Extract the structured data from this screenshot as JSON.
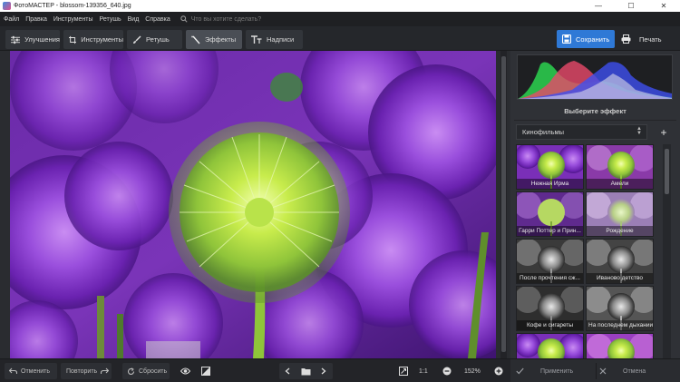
{
  "window": {
    "title": "ФотоМАСТЕР - blossom-139356_640.jpg",
    "minimize": "—",
    "maximize": "☐",
    "close": "✕"
  },
  "menu": {
    "items": [
      "Файл",
      "Правка",
      "Инструменты",
      "Ретушь",
      "Вид",
      "Справка"
    ],
    "search_placeholder": "Что вы хотите сделать?"
  },
  "toolbar": {
    "tabs": [
      {
        "label": "Улучшения",
        "icon": "sliders-icon"
      },
      {
        "label": "Инструменты",
        "icon": "crop-icon"
      },
      {
        "label": "Ретушь",
        "icon": "brush-icon"
      },
      {
        "label": "Эффекты",
        "icon": "magic-wand-icon",
        "active": true
      },
      {
        "label": "Надписи",
        "icon": "text-icon"
      }
    ],
    "save_label": "Сохранить",
    "print_label": "Печать"
  },
  "panel": {
    "title": "Выберите эффект",
    "category": "Кинофильмы",
    "effects": [
      {
        "label": "Нежная Ирма",
        "style": "color"
      },
      {
        "label": "Амели",
        "style": "color"
      },
      {
        "label": "Гарри Поттер и Прин...",
        "style": "color"
      },
      {
        "label": "Рождение",
        "style": "pale"
      },
      {
        "label": "После прочтения сж...",
        "style": "mono"
      },
      {
        "label": "Иваново детство",
        "style": "mono"
      },
      {
        "label": "Кофе и сигареты",
        "style": "mono"
      },
      {
        "label": "На последнем дыхании",
        "style": "mono"
      },
      {
        "label": "",
        "style": "color"
      },
      {
        "label": "",
        "style": "color"
      }
    ]
  },
  "bottombar": {
    "undo_label": "Отменить",
    "redo_label": "Повторить",
    "reset_label": "Сбросить",
    "zoom_one": "1:1",
    "zoom_level": "152%",
    "apply_label": "Применить",
    "cancel_label": "Отмена"
  },
  "colors": {
    "accent": "#2f79d6",
    "background": "#2b2d31",
    "panel": "#2f3136"
  }
}
